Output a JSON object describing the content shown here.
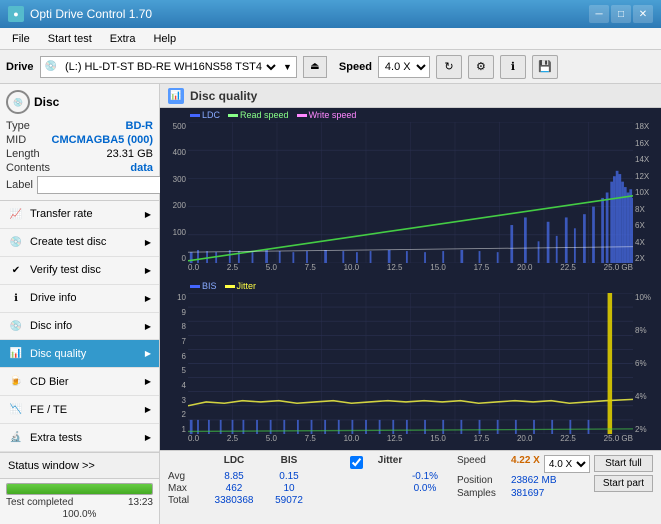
{
  "titlebar": {
    "title": "Opti Drive Control 1.70",
    "controls": [
      "minimize",
      "maximize",
      "close"
    ]
  },
  "menubar": {
    "items": [
      "File",
      "Start test",
      "Extra",
      "Help"
    ]
  },
  "toolbar": {
    "drive_label": "Drive",
    "drive_value": "(L:) HL-DT-ST BD-RE WH16NS58 TST4",
    "speed_label": "Speed",
    "speed_value": "4.0 X"
  },
  "sidebar": {
    "disc_section": {
      "title": "Disc",
      "type_label": "Type",
      "type_value": "BD-R",
      "mid_label": "MID",
      "mid_value": "CMCMAGBA5 (000)",
      "length_label": "Length",
      "length_value": "23.31 GB",
      "contents_label": "Contents",
      "contents_value": "data",
      "label_label": "Label"
    },
    "nav_items": [
      {
        "id": "transfer-rate",
        "label": "Transfer rate",
        "active": false
      },
      {
        "id": "create-test-disc",
        "label": "Create test disc",
        "active": false
      },
      {
        "id": "verify-test-disc",
        "label": "Verify test disc",
        "active": false
      },
      {
        "id": "drive-info",
        "label": "Drive info",
        "active": false
      },
      {
        "id": "disc-info",
        "label": "Disc info",
        "active": false
      },
      {
        "id": "disc-quality",
        "label": "Disc quality",
        "active": true
      },
      {
        "id": "cd-bier",
        "label": "CD Bier",
        "active": false
      },
      {
        "id": "fe-te",
        "label": "FE / TE",
        "active": false
      },
      {
        "id": "extra-tests",
        "label": "Extra tests",
        "active": false
      }
    ],
    "status_window": "Status window >>",
    "progress_pct": "100.0%",
    "status_text": "Test completed",
    "timestamp": "13:23"
  },
  "disc_quality": {
    "title": "Disc quality",
    "legend": {
      "ldc": "LDC",
      "read_speed": "Read speed",
      "write_speed": "Write speed",
      "bis": "BIS",
      "jitter": "Jitter"
    },
    "top_chart": {
      "y_labels": [
        "500",
        "400",
        "300",
        "200",
        "100",
        "0"
      ],
      "y_labels_right": [
        "18X",
        "16X",
        "14X",
        "12X",
        "10X",
        "8X",
        "6X",
        "4X",
        "2X"
      ],
      "x_labels": [
        "0.0",
        "2.5",
        "5.0",
        "7.5",
        "10.0",
        "12.5",
        "15.0",
        "17.5",
        "20.0",
        "22.5",
        "25.0 GB"
      ]
    },
    "bottom_chart": {
      "y_labels": [
        "10",
        "9",
        "8",
        "7",
        "6",
        "5",
        "4",
        "3",
        "2",
        "1"
      ],
      "y_labels_right": [
        "10%",
        "8%",
        "6%",
        "4%",
        "2%"
      ],
      "x_labels": [
        "0.0",
        "2.5",
        "5.0",
        "7.5",
        "10.0",
        "12.5",
        "15.0",
        "17.5",
        "20.0",
        "22.5",
        "25.0 GB"
      ]
    }
  },
  "stats": {
    "columns": [
      "LDC",
      "BIS",
      "",
      "Jitter",
      "Speed",
      ""
    ],
    "avg_label": "Avg",
    "avg_ldc": "8.85",
    "avg_bis": "0.15",
    "avg_jitter": "-0.1%",
    "max_label": "Max",
    "max_ldc": "462",
    "max_bis": "10",
    "max_jitter": "0.0%",
    "total_label": "Total",
    "total_ldc": "3380368",
    "total_bis": "59072",
    "jitter_checked": true,
    "jitter_label": "Jitter",
    "speed_label": "Speed",
    "speed_value": "4.22 X",
    "speed_select": "4.0 X",
    "position_label": "Position",
    "position_value": "23862 MB",
    "samples_label": "Samples",
    "samples_value": "381697",
    "start_full_label": "Start full",
    "start_part_label": "Start part"
  }
}
